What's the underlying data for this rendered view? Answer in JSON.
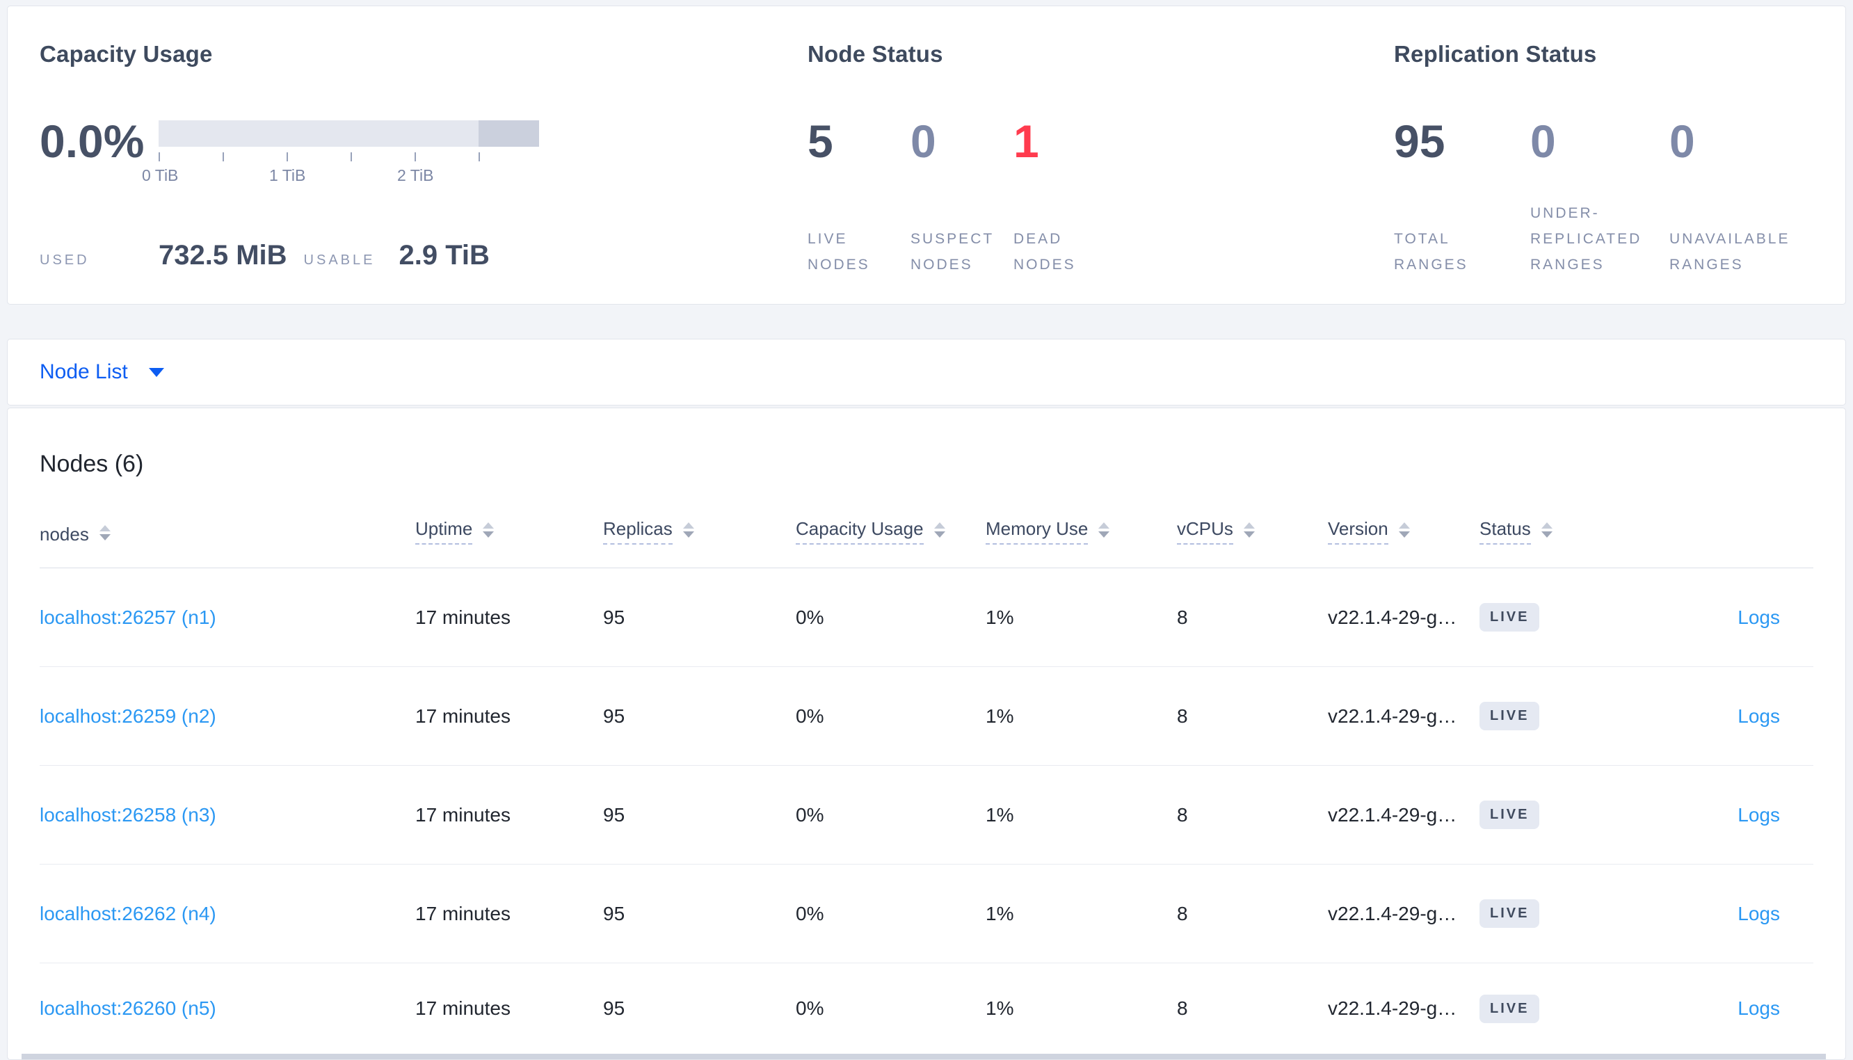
{
  "stats": {
    "capacity": {
      "title": "Capacity Usage",
      "percent": "0.0%",
      "ticks": [
        "0 TiB",
        "1 TiB",
        "2 TiB"
      ],
      "used_label": "USED",
      "used_value": "732.5 MiB",
      "usable_label": "USABLE",
      "usable_value": "2.9 TiB"
    },
    "node_status": {
      "title": "Node Status",
      "stats": [
        {
          "value": "5",
          "label": "LIVE NODES"
        },
        {
          "value": "0",
          "label": "SUSPECT NODES"
        },
        {
          "value": "1",
          "label": "DEAD NODES"
        }
      ]
    },
    "replication": {
      "title": "Replication Status",
      "stats": [
        {
          "value": "95",
          "label": "TOTAL RANGES"
        },
        {
          "value": "0",
          "label": "UNDER-REPLICATED RANGES"
        },
        {
          "value": "0",
          "label": "UNAVAILABLE RANGES"
        }
      ]
    }
  },
  "node_list": {
    "dropdown_label": "Node List"
  },
  "nodes_section": {
    "heading": "Nodes (6)",
    "columns": [
      {
        "label": "nodes",
        "sortable": true,
        "has_tooltip": false
      },
      {
        "label": "Uptime",
        "sortable": true,
        "has_tooltip": true
      },
      {
        "label": "Replicas",
        "sortable": true,
        "has_tooltip": true
      },
      {
        "label": "Capacity Usage",
        "sortable": true,
        "has_tooltip": true
      },
      {
        "label": "Memory Use",
        "sortable": true,
        "has_tooltip": true
      },
      {
        "label": "vCPUs",
        "sortable": true,
        "has_tooltip": true
      },
      {
        "label": "Version",
        "sortable": true,
        "has_tooltip": true
      },
      {
        "label": "Status",
        "sortable": true,
        "has_tooltip": true
      }
    ],
    "rows": [
      {
        "node": "localhost:26257 (n1)",
        "uptime": "17 minutes",
        "replicas": "95",
        "capacity": "0%",
        "memory": "1%",
        "vcpus": "8",
        "version": "v22.1.4-29-g…",
        "status": "LIVE",
        "logs": "Logs"
      },
      {
        "node": "localhost:26259 (n2)",
        "uptime": "17 minutes",
        "replicas": "95",
        "capacity": "0%",
        "memory": "1%",
        "vcpus": "8",
        "version": "v22.1.4-29-g…",
        "status": "LIVE",
        "logs": "Logs"
      },
      {
        "node": "localhost:26258 (n3)",
        "uptime": "17 minutes",
        "replicas": "95",
        "capacity": "0%",
        "memory": "1%",
        "vcpus": "8",
        "version": "v22.1.4-29-g…",
        "status": "LIVE",
        "logs": "Logs"
      },
      {
        "node": "localhost:26262 (n4)",
        "uptime": "17 minutes",
        "replicas": "95",
        "capacity": "0%",
        "memory": "1%",
        "vcpus": "8",
        "version": "v22.1.4-29-g…",
        "status": "LIVE",
        "logs": "Logs"
      },
      {
        "node": "localhost:26260 (n5)",
        "uptime": "17 minutes",
        "replicas": "95",
        "capacity": "0%",
        "memory": "1%",
        "vcpus": "8",
        "version": "v22.1.4-29-g…",
        "status": "LIVE",
        "logs": "Logs"
      }
    ]
  },
  "colors": {
    "accent_link": "#2b98f3",
    "dropdown_link": "#0d5df2",
    "dead_red": "#ff3b4e",
    "stat_dark": "#475166",
    "stat_muted": "#7e89a8",
    "badge_bg": "#e5e9f2"
  }
}
